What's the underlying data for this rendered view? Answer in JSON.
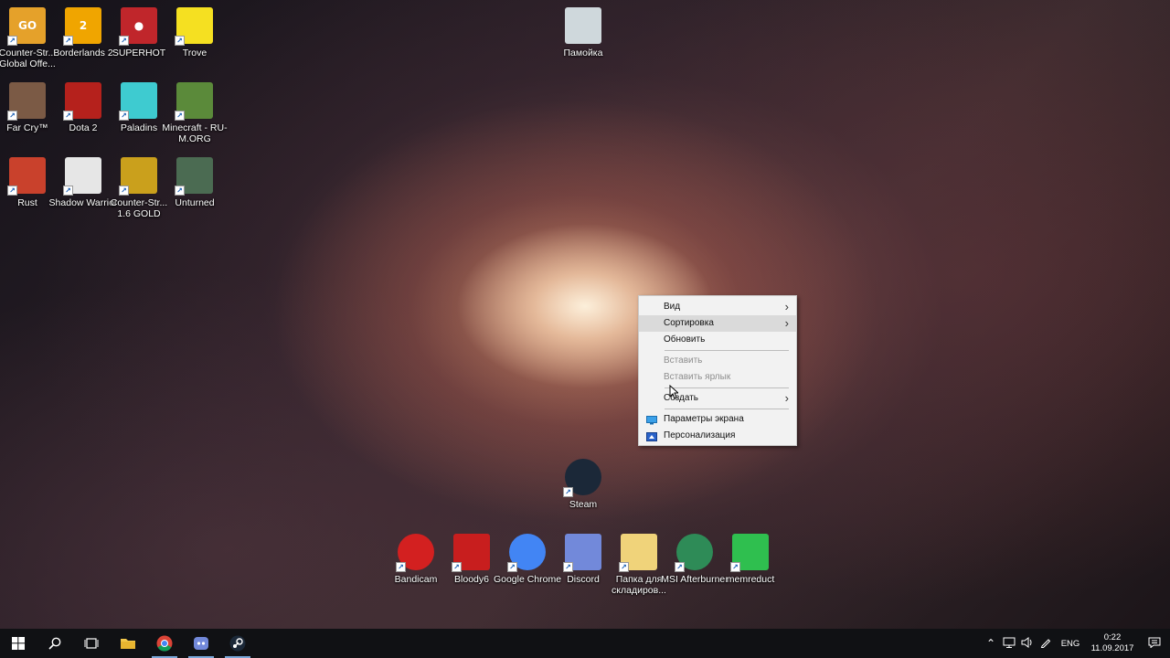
{
  "desktop": {
    "icons": [
      {
        "label": "Counter-Str... Global Offe...",
        "glyph": "GO",
        "color": "#e5a12a"
      },
      {
        "label": "Borderlands 2",
        "glyph": "2",
        "color": "#f0a500"
      },
      {
        "label": "SUPERHOT",
        "glyph": "●",
        "color": "#c0262b"
      },
      {
        "label": "Trove",
        "glyph": "",
        "color": "#f5e021"
      },
      {
        "label": "Far Cry™",
        "glyph": "",
        "color": "#7b5a45"
      },
      {
        "label": "Dota 2",
        "glyph": "",
        "color": "#b5211c"
      },
      {
        "label": "Paladins",
        "glyph": "",
        "color": "#3ecbd0"
      },
      {
        "label": "Minecraft - RU-M.ORG",
        "glyph": "",
        "color": "#5b8a3a"
      },
      {
        "label": "Rust",
        "glyph": "",
        "color": "#c9412c"
      },
      {
        "label": "Shadow Warrior",
        "glyph": "",
        "color": "#e6e6e6"
      },
      {
        "label": "Counter-Str... 1.6 GOLD",
        "glyph": "",
        "color": "#caa01c"
      },
      {
        "label": "Unturned",
        "glyph": "",
        "color": "#4b6b52"
      },
      {
        "label": "Памойка",
        "glyph": "",
        "color": "#cfd8dc"
      },
      {
        "label": "Steam",
        "glyph": "",
        "color": "#1b2838"
      },
      {
        "label": "Bandicam",
        "glyph": "",
        "color": "#d32020"
      },
      {
        "label": "Bloody6",
        "glyph": "",
        "color": "#c81e1e"
      },
      {
        "label": "Google Chrome",
        "glyph": "",
        "color": "#4285f4"
      },
      {
        "label": "Discord",
        "glyph": "",
        "color": "#7289da"
      },
      {
        "label": "Папка для складиров...",
        "glyph": "",
        "color": "#f0d37a"
      },
      {
        "label": "MSI Afterburner",
        "glyph": "",
        "color": "#2e8b57"
      },
      {
        "label": "memreduct",
        "glyph": "",
        "color": "#2fbf4f"
      }
    ]
  },
  "context_menu": {
    "items": {
      "view": "Вид",
      "sort": "Сортировка",
      "refresh": "Обновить",
      "paste": "Вставить",
      "paste_shortcut": "Вставить ярлык",
      "create": "Создать",
      "display_settings": "Параметры экрана",
      "personalize": "Персонализация"
    },
    "highlighted": "Сортировка"
  },
  "taskbar": {
    "tray": {
      "language": "ENG",
      "time": "0:22",
      "date": "11.09.2017"
    },
    "accent_color": "#7aa7d8"
  }
}
